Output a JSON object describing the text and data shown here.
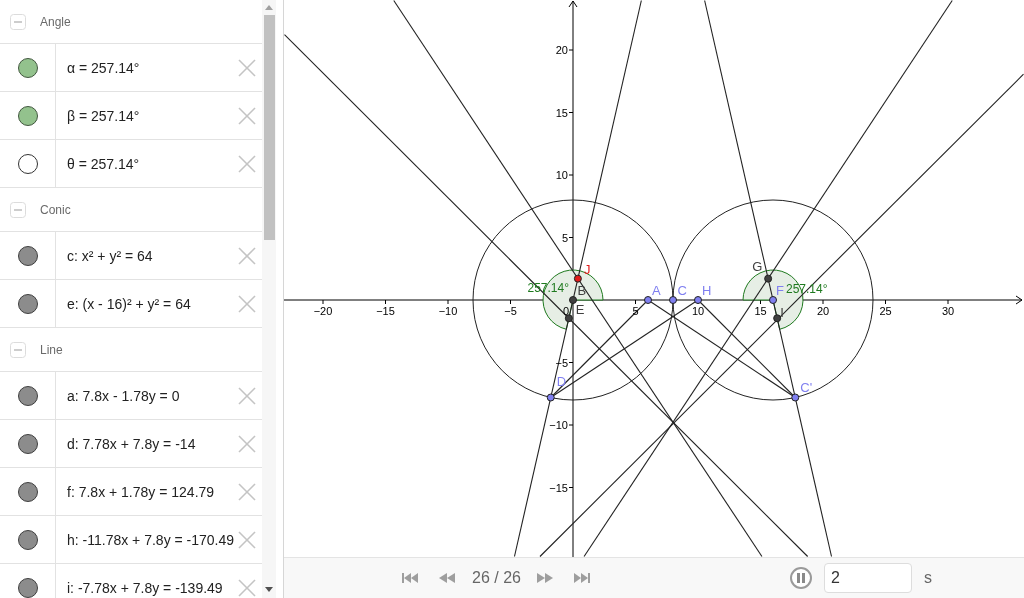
{
  "algebra": {
    "sections": [
      {
        "title": "Angle",
        "expanded": true,
        "items": [
          {
            "text": "α = 257.14°",
            "visible": true,
            "color": "#93c28d"
          },
          {
            "text": "β = 257.14°",
            "visible": true,
            "color": "#93c28d"
          },
          {
            "text": "θ = 257.14°",
            "visible": false
          }
        ]
      },
      {
        "title": "Conic",
        "expanded": true,
        "items": [
          {
            "text": "c: x² + y² = 64",
            "visible": true,
            "color": "#8c8c8c"
          },
          {
            "text": "e: (x - 16)² + y² = 64",
            "visible": true,
            "color": "#8c8c8c"
          }
        ]
      },
      {
        "title": "Line",
        "expanded": true,
        "items": [
          {
            "text": "a: 7.8x - 1.78y = 0",
            "visible": true,
            "color": "#8c8c8c"
          },
          {
            "text": "d: 7.78x + 7.8y = -14",
            "visible": true,
            "color": "#8c8c8c"
          },
          {
            "text": "f: 7.8x + 1.78y = 124.79",
            "visible": true,
            "color": "#8c8c8c"
          },
          {
            "text": "h: -11.78x + 7.8y = -170.49",
            "visible": true,
            "color": "#8c8c8c"
          },
          {
            "text": "i: -7.78x + 7.8y = -139.49",
            "visible": true,
            "color": "#8c8c8c"
          }
        ]
      }
    ]
  },
  "graphics": {
    "x_axis_labels": [
      "−20",
      "−15",
      "−10",
      "−5",
      "0",
      "5",
      "10",
      "15",
      "20",
      "25",
      "30"
    ],
    "y_axis_labels": [
      "20",
      "15",
      "10",
      "5",
      "−5",
      "−10",
      "−15"
    ],
    "points": [
      {
        "label": "J",
        "color": "#e01b1b"
      },
      {
        "label": "G",
        "color": "#404040"
      },
      {
        "label": "B",
        "color": "#404040"
      },
      {
        "label": "A",
        "color": "#7f7ff0"
      },
      {
        "label": "C",
        "color": "#7f7ff0"
      },
      {
        "label": "H",
        "color": "#7f7ff0"
      },
      {
        "label": "F",
        "color": "#7f7ff0"
      },
      {
        "label": "E",
        "color": "#404040"
      },
      {
        "label": "I",
        "color": "#404040"
      },
      {
        "label": "D",
        "color": "#7f7ff0"
      },
      {
        "label": "C'",
        "color": "#7f7ff0"
      }
    ],
    "angle_labels": [
      "257.14°",
      "257.14°"
    ]
  },
  "player": {
    "position": "26 / 26",
    "playing": true,
    "speed": "2",
    "unit": "s"
  }
}
